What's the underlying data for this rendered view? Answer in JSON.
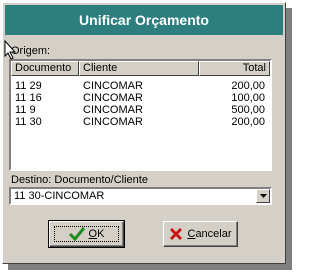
{
  "window": {
    "title": "Unificar Orçamento"
  },
  "origin": {
    "label": "Origem:"
  },
  "table": {
    "columns": [
      "Documento",
      "Cliente",
      "Total"
    ],
    "rows": [
      {
        "documento": "11 29",
        "cliente": "CINCOMAR",
        "total": "200,00"
      },
      {
        "documento": "11 16",
        "cliente": "CINCOMAR",
        "total": "100,00"
      },
      {
        "documento": "11 9",
        "cliente": "CINCOMAR",
        "total": "500,00"
      },
      {
        "documento": "11 30",
        "cliente": "CINCOMAR",
        "total": "200,00"
      }
    ]
  },
  "destination": {
    "label": "Destino: Documento/Cliente",
    "value": "11 30-CINCOMAR"
  },
  "buttons": {
    "ok": {
      "label": "OK",
      "mnemonic": "O",
      "rest": "K",
      "icon": "check-icon"
    },
    "cancel": {
      "label": "Cancelar",
      "mnemonic": "C",
      "rest": "ancelar",
      "icon": "x-icon"
    }
  },
  "colors": {
    "title_bar": "#2d7f7f",
    "dialog_bg": "#d4d0c8",
    "ok_check": "#1e8c1e",
    "cancel_x": "#c81414"
  }
}
